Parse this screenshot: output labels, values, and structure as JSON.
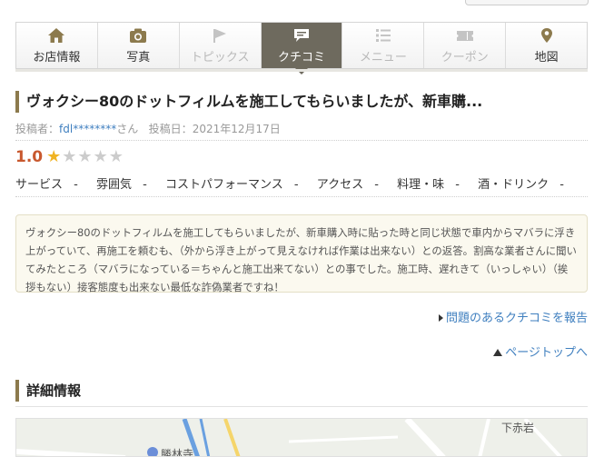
{
  "tabs": [
    {
      "label": "お店情報",
      "icon": "home-icon",
      "state": "normal"
    },
    {
      "label": "写真",
      "icon": "camera-icon",
      "state": "normal"
    },
    {
      "label": "トピックス",
      "icon": "flag-icon",
      "state": "disabled"
    },
    {
      "label": "クチコミ",
      "icon": "speech-bubble-icon",
      "state": "active"
    },
    {
      "label": "メニュー",
      "icon": "list-icon",
      "state": "disabled"
    },
    {
      "label": "クーポン",
      "icon": "coupon-icon",
      "state": "disabled"
    },
    {
      "label": "地図",
      "icon": "map-pin-icon",
      "state": "normal"
    }
  ],
  "review": {
    "title": "ヴォクシー80のドットフィルムを施工してもらいましたが、新車購...",
    "poster_prefix": "投稿者：",
    "poster_name": "fdl********",
    "poster_suffix": "さん",
    "date_prefix": "投稿日：",
    "date": "2021年12月17日",
    "score": "1.0",
    "stars_on": 1,
    "stars_total": 5,
    "categories": [
      {
        "label": "サービス",
        "value": "-"
      },
      {
        "label": "雰囲気",
        "value": "-"
      },
      {
        "label": "コストパフォーマンス",
        "value": "-"
      },
      {
        "label": "アクセス",
        "value": "-"
      },
      {
        "label": "料理・味",
        "value": "-"
      },
      {
        "label": "酒・ドリンク",
        "value": "-"
      }
    ],
    "body": "ヴォクシー80のドットフィルムを施工してもらいましたが、新車購入時に貼った時と同じ状態で車内からマバラに浮き上がっていて、再施工を頼むも、（外から浮き上がって見えなければ作業は出来ない）との返答。割高な業者さんに聞いてみたところ（マバラになっている＝ちゃんと施工出来てない）との事でした。施工時、遅れきて（いっしゃい）（挨拶もない）接客態度も出来ない最低な詐偽業者ですね！",
    "report_link": "問題のあるクチコミを報告"
  },
  "page_top_link": "ページトップへ",
  "details_title": "詳細情報",
  "map": {
    "labels": [
      "下赤岩",
      "勝林寺"
    ]
  },
  "colors": {
    "accent": "#8c7a4d",
    "active_tab": "#6e6a5e",
    "link": "#3f7fbf",
    "score": "#c8582e",
    "star_on": "#f0b323"
  }
}
